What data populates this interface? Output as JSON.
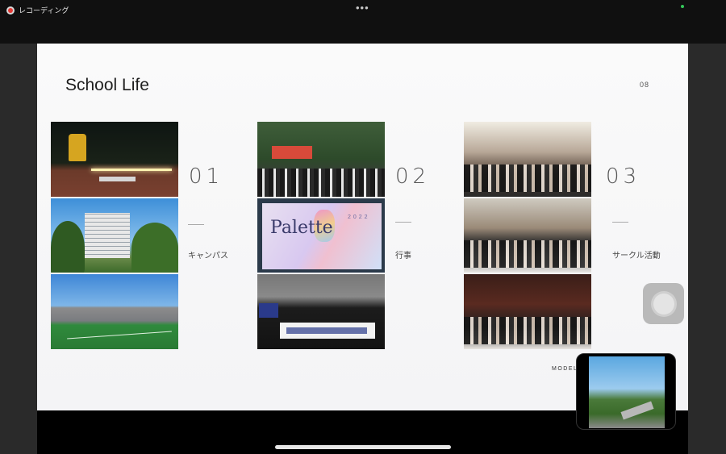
{
  "status_bar": {
    "recording_label": "レコーディング",
    "menu_dots": "•••"
  },
  "slide": {
    "title": "School Life",
    "page_number": "08",
    "watermark": "MODELL",
    "sections": [
      {
        "number": "01",
        "label": "キャンパス"
      },
      {
        "number": "02",
        "label": "行事"
      },
      {
        "number": "03",
        "label": "サークル活動"
      }
    ],
    "photo_text": {
      "palette_title": "Palette",
      "palette_year": "2022"
    }
  },
  "colors": {
    "slide_background": "#fafafa",
    "top_bar": "#101010",
    "recording": "#e53935",
    "active_indicator": "#34c759"
  },
  "icons": [
    "record-icon",
    "more-dots-icon",
    "assistive-touch-icon"
  ]
}
